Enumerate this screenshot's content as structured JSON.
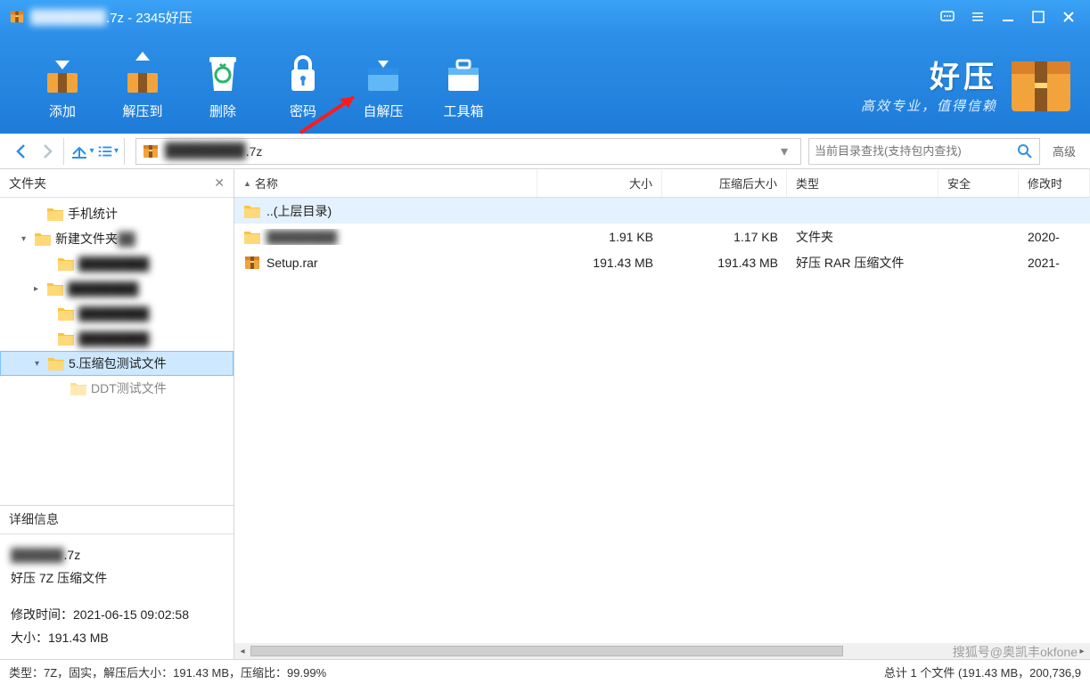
{
  "title": {
    "suffix": ".7z - 2345好压",
    "obscured_prefix": "████████"
  },
  "toolbar": {
    "add": "添加",
    "extract": "解压到",
    "delete": "删除",
    "password": "密码",
    "sfx": "自解压",
    "tools": "工具箱"
  },
  "brand": {
    "name": "好压",
    "slogan": "高效专业，值得信赖"
  },
  "nav": {
    "addrpath": ".7z",
    "search_placeholder": "当前目录查找(支持包内查找)",
    "advanced": "高级"
  },
  "sidebar": {
    "folders_header": "文件夹",
    "details_header": "详细信息",
    "tree": [
      {
        "label": "手机统计",
        "indent": 28
      },
      {
        "label": "新建文件夹",
        "indent": 14,
        "expander": "▾",
        "obscure_tail": true
      },
      {
        "label": "████████",
        "indent": 40,
        "blur": true
      },
      {
        "label": "████████",
        "indent": 28,
        "expander": "▸",
        "blur": true
      },
      {
        "label": "████████",
        "indent": 40,
        "blur": true
      },
      {
        "label": "████████",
        "indent": 40,
        "blur": true
      },
      {
        "label": "5.压缩包测试文件",
        "indent": 28,
        "expander": "▾",
        "selected": true
      },
      {
        "label": "DDT测试文件",
        "indent": 54,
        "cut": true
      }
    ],
    "details": {
      "filename_suffix": ".7z",
      "filetype": "好压 7Z 压缩文件",
      "mtime_label": "修改时间：",
      "mtime": "2021-06-15 09:02:58",
      "size_label": "大小：",
      "size": "191.43 MB"
    }
  },
  "columns": {
    "name": "名称",
    "size": "大小",
    "csize": "压缩后大小",
    "type": "类型",
    "safe": "安全",
    "mtime": "修改时"
  },
  "rows": [
    {
      "icon": "folder",
      "name": "..(上层目录)",
      "size": "",
      "csize": "",
      "type": "",
      "mtime": "",
      "selected": true
    },
    {
      "icon": "folder",
      "name": "████████",
      "name_blur": true,
      "size": "1.91 KB",
      "csize": "1.17 KB",
      "type": "文件夹",
      "mtime": "2020-"
    },
    {
      "icon": "archive",
      "name": "Setup.rar",
      "size": "191.43 MB",
      "csize": "191.43 MB",
      "type": "好压 RAR 压缩文件",
      "mtime": "2021-"
    }
  ],
  "status": {
    "left": "类型：7Z，固实，解压后大小：191.43 MB，压缩比：99.99%",
    "right": "总计 1 个文件 (191.43 MB，200,736,9"
  },
  "watermark": "搜狐号@奥凯丰okfone"
}
